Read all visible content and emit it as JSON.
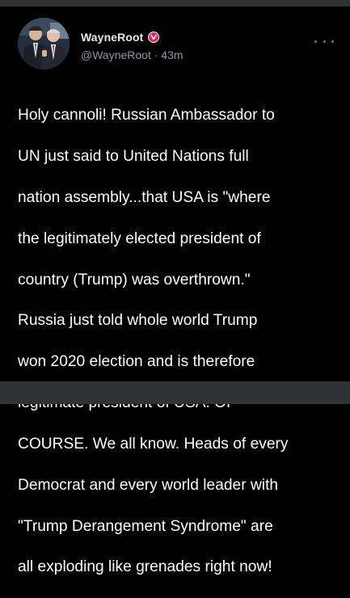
{
  "tweet": {
    "display_name": "WayneRoot",
    "handle": "@WayneRoot",
    "separator": "·",
    "time": "43m",
    "avatar_icon": "avatar-photo",
    "badge_icon": "v-badge-icon",
    "more_icon": "more-options-icon",
    "text_lines": [
      "Holy cannoli! Russian Ambassador to",
      "UN just said to United Nations full",
      "nation assembly...that USA is \"where",
      "the legitimately elected president of",
      "country (Trump) was overthrown.\"",
      "Russia just told whole world Trump",
      "won 2020 election and is therefore",
      "legitimate president of USA. OF",
      "COURSE. We all know. Heads of every",
      "Democrat and every world leader with",
      "\"Trump Derangement Syndrome\" are",
      "all exploding like grenades right now!"
    ]
  },
  "colors": {
    "background": "#000000",
    "text_primary": "#ffffff",
    "text_secondary": "#8b98a5",
    "badge": "#e0245e",
    "divider": "#2f3336"
  }
}
